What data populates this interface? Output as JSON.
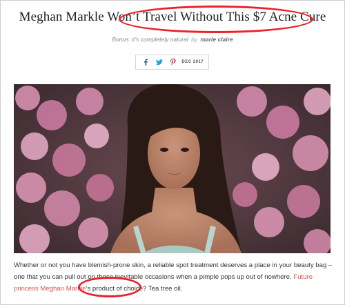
{
  "article": {
    "title": "Meghan Markle Won’t Travel Without This $7 Acne Cure",
    "subtitle": "Bonus: it’s completely natural",
    "by": "by",
    "source": "marie claire",
    "date": "DEC 2017",
    "body_before_link": "Whether or not you have blemish-prone skin, a reliable spot treatment deserves a place in your beauty bag – one that you can pull out on those inevitable occasions when a pimple pops up out of nowhere. ",
    "body_link": "Future princess Meghan Markle",
    "body_after_link": "’s product of choice? Tea tree oil."
  },
  "share_icons": [
    "facebook-icon",
    "twitter-icon",
    "pinterest-icon"
  ],
  "colors": {
    "annotation": "#e8232a",
    "link": "#d9534f",
    "facebook": "#3b5998",
    "twitter": "#1da1f2",
    "pinterest": "#cb2027"
  }
}
